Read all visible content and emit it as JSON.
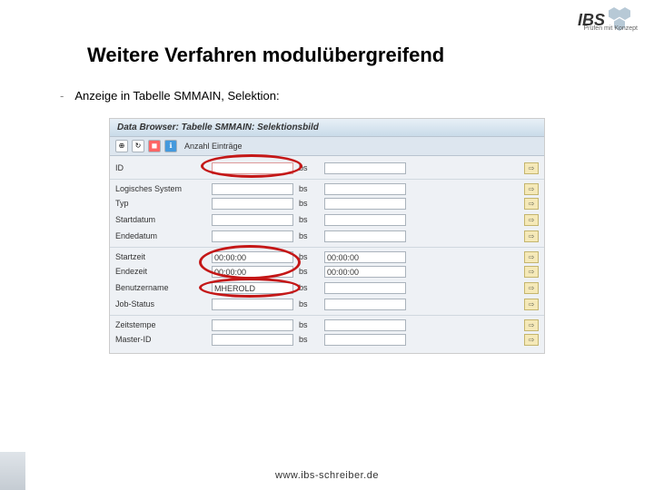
{
  "logo": {
    "text": "IBS",
    "tagline": "Prüfen mit Konzept"
  },
  "title": "Weitere Verfahren modulübergreifend",
  "bullet": {
    "dash": "-",
    "text": "Anzeige in Tabelle SMMAIN, Selektion:"
  },
  "screenshot": {
    "title": "Data Browser: Tabelle SMMAIN: Selektionsbild",
    "toolbar": {
      "entries_label": "Anzahl Einträge"
    },
    "bs": "bs",
    "fields": {
      "id": "ID",
      "logsys": "Logisches System",
      "typ": "Typ",
      "startdatum": "Startdatum",
      "endedatum": "Endedatum",
      "startzeit": "Startzeit",
      "endezeit": "Endezeit",
      "benutzer": "Benutzername",
      "jobstatus": "Job-Status",
      "zeitstempel": "Zeitstempe",
      "masterid": "Master-ID"
    },
    "values": {
      "startzeit_from": "00:00:00",
      "startzeit_to": "00:00:00",
      "endezeit_from": "00:00:00",
      "endezeit_to": "00:00:00",
      "benutzer": "MHEROLD"
    }
  },
  "footer": {
    "url": "www.ibs-schreiber.de"
  }
}
